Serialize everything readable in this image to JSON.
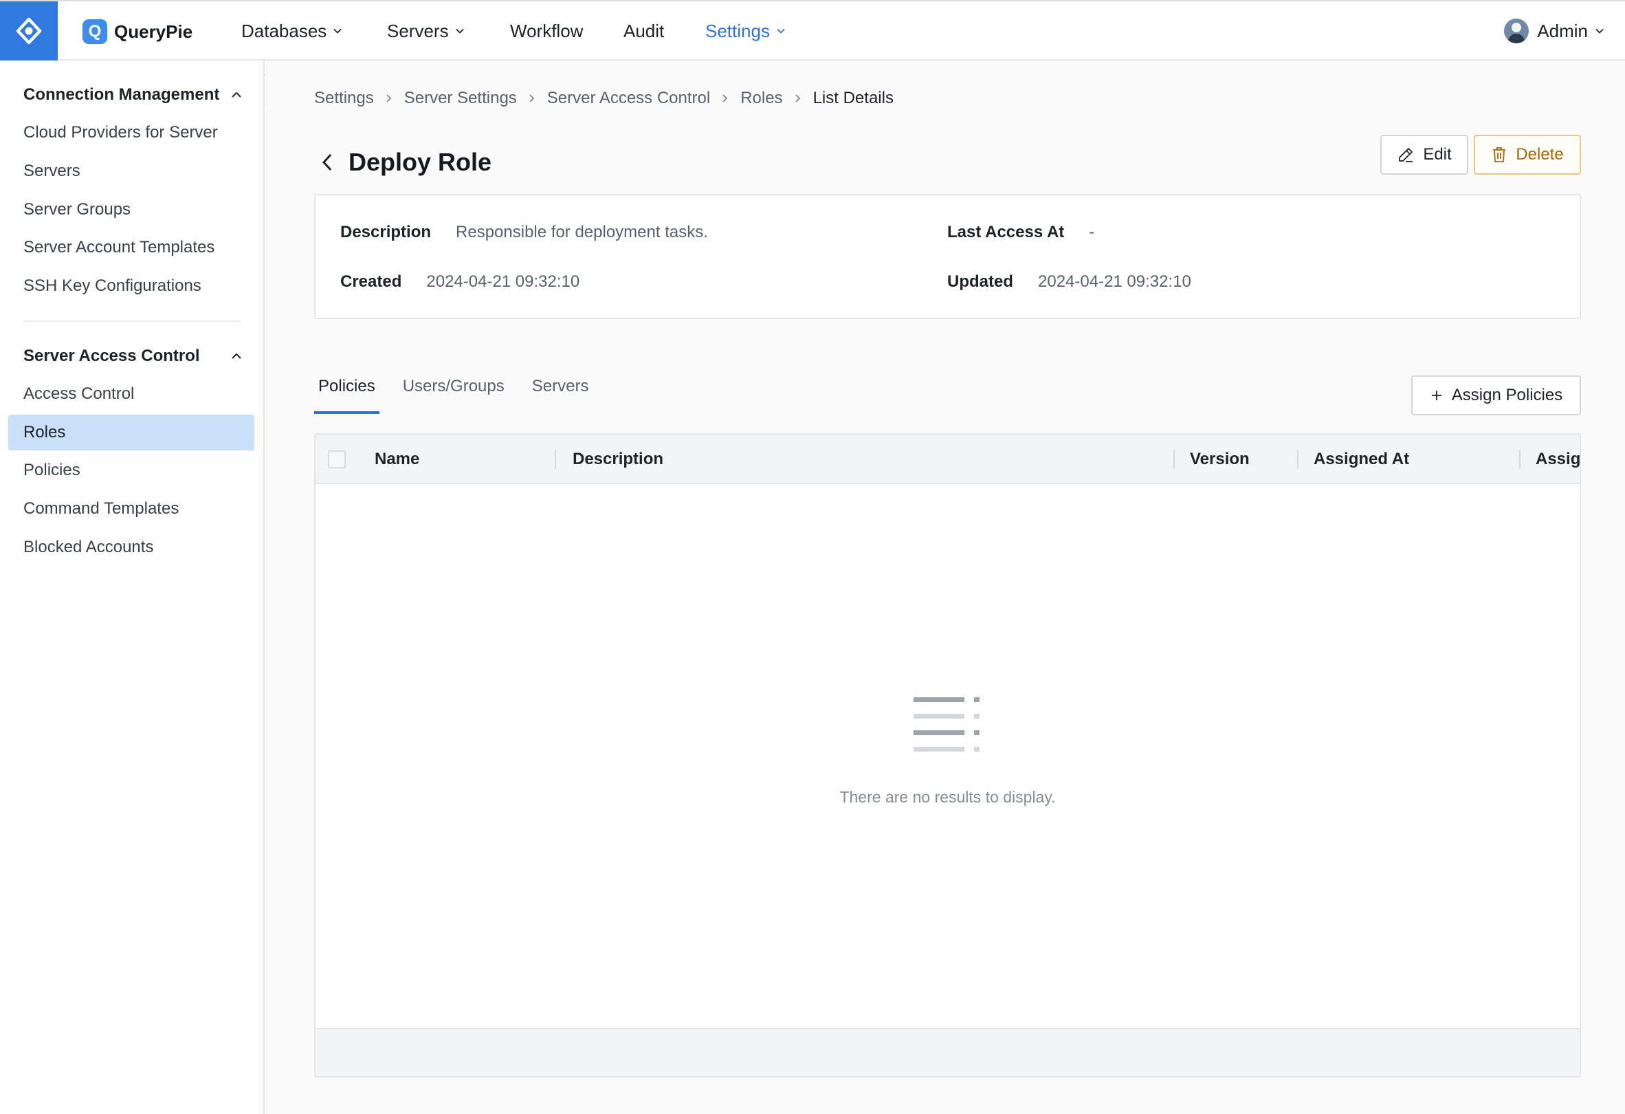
{
  "app": {
    "name": "QueryPie",
    "brand_letter": "Q"
  },
  "nav": {
    "items": [
      {
        "label": "Databases"
      },
      {
        "label": "Servers"
      },
      {
        "label": "Workflow"
      },
      {
        "label": "Audit"
      },
      {
        "label": "Settings"
      }
    ],
    "user": "Admin"
  },
  "sidebar": {
    "groups": [
      {
        "title": "Connection Management",
        "items": [
          "Cloud Providers for Server",
          "Servers",
          "Server Groups",
          "Server Account Templates",
          "SSH Key Configurations"
        ]
      },
      {
        "title": "Server Access Control",
        "items": [
          "Access Control",
          "Roles",
          "Policies",
          "Command Templates",
          "Blocked Accounts"
        ]
      }
    ],
    "selected": "Roles"
  },
  "breadcrumb": [
    "Settings",
    "Server Settings",
    "Server Access Control",
    "Roles",
    "List Details"
  ],
  "page": {
    "title": "Deploy Role",
    "edit_label": "Edit",
    "delete_label": "Delete"
  },
  "details": {
    "description_label": "Description",
    "description_value": "Responsible for deployment tasks.",
    "last_access_label": "Last Access At",
    "last_access_value": "-",
    "created_label": "Created",
    "created_value": "2024-04-21 09:32:10",
    "updated_label": "Updated",
    "updated_value": "2024-04-21 09:32:10"
  },
  "tabs": [
    "Policies",
    "Users/Groups",
    "Servers"
  ],
  "active_tab": "Policies",
  "assign_label": "Assign Policies",
  "table": {
    "columns": [
      "Name",
      "Description",
      "Version",
      "Assigned At",
      "Assig"
    ],
    "empty_text": "There are no results to display."
  },
  "colors": {
    "accent": "#2f73d8",
    "sidebar_selected": "#c9dffa",
    "delete": "#a8660a"
  }
}
